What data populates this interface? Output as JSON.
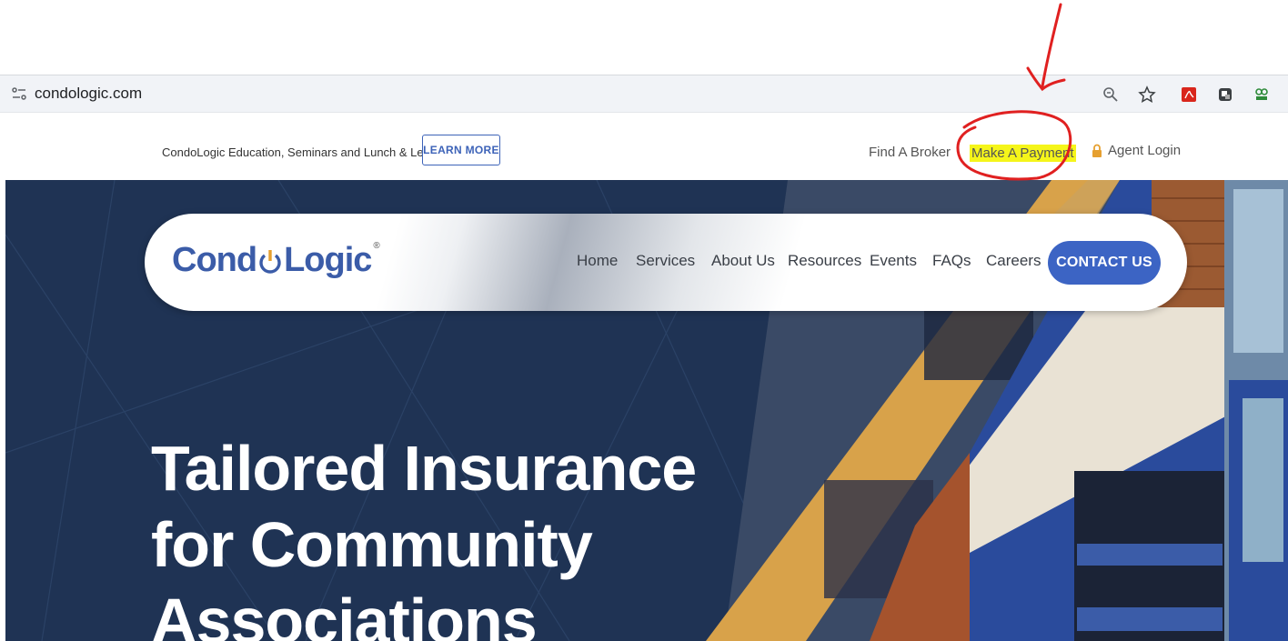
{
  "browser": {
    "url": "condologic.com",
    "icons": [
      "tune-icon",
      "zoom-icon",
      "star-icon",
      "pdf-extension-icon",
      "extension-icon",
      "extension-icon-2"
    ]
  },
  "topbar": {
    "promo_text": "CondoLogic Education, Seminars and Lunch & Learns Available!",
    "learn_more_label": "LEARN MORE",
    "find_broker_label": "Find A Broker",
    "make_payment_label": "Make A Payment",
    "agent_login_label": "Agent Login"
  },
  "logo": {
    "part1": "Cond",
    "part2": "Logic",
    "reg": "®"
  },
  "nav": {
    "items": [
      {
        "label": "Home"
      },
      {
        "label": "Services"
      },
      {
        "label": "About Us"
      },
      {
        "label": "Resources"
      },
      {
        "label": "Events"
      },
      {
        "label": "FAQs"
      },
      {
        "label": "Careers"
      }
    ],
    "contact_label": "CONTACT US"
  },
  "hero": {
    "headline_lines": [
      "Tailored Insurance",
      "for Community",
      "Associations"
    ]
  },
  "colors": {
    "brand_blue": "#3c64c4",
    "brand_orange": "#e6a030",
    "hero_navy": "#1f3354",
    "highlight": "#f5f51a",
    "annotation_red": "#e02020"
  }
}
